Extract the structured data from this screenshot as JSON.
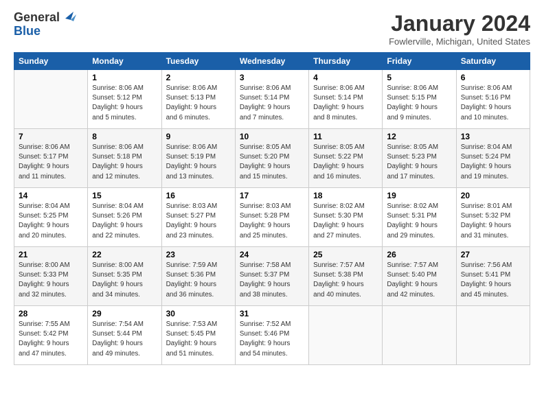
{
  "header": {
    "logo_line1": "General",
    "logo_line2": "Blue",
    "month": "January 2024",
    "location": "Fowlerville, Michigan, United States"
  },
  "weekdays": [
    "Sunday",
    "Monday",
    "Tuesday",
    "Wednesday",
    "Thursday",
    "Friday",
    "Saturday"
  ],
  "weeks": [
    [
      {
        "day": "",
        "info": ""
      },
      {
        "day": "1",
        "info": "Sunrise: 8:06 AM\nSunset: 5:12 PM\nDaylight: 9 hours\nand 5 minutes."
      },
      {
        "day": "2",
        "info": "Sunrise: 8:06 AM\nSunset: 5:13 PM\nDaylight: 9 hours\nand 6 minutes."
      },
      {
        "day": "3",
        "info": "Sunrise: 8:06 AM\nSunset: 5:14 PM\nDaylight: 9 hours\nand 7 minutes."
      },
      {
        "day": "4",
        "info": "Sunrise: 8:06 AM\nSunset: 5:14 PM\nDaylight: 9 hours\nand 8 minutes."
      },
      {
        "day": "5",
        "info": "Sunrise: 8:06 AM\nSunset: 5:15 PM\nDaylight: 9 hours\nand 9 minutes."
      },
      {
        "day": "6",
        "info": "Sunrise: 8:06 AM\nSunset: 5:16 PM\nDaylight: 9 hours\nand 10 minutes."
      }
    ],
    [
      {
        "day": "7",
        "info": "Sunrise: 8:06 AM\nSunset: 5:17 PM\nDaylight: 9 hours\nand 11 minutes."
      },
      {
        "day": "8",
        "info": "Sunrise: 8:06 AM\nSunset: 5:18 PM\nDaylight: 9 hours\nand 12 minutes."
      },
      {
        "day": "9",
        "info": "Sunrise: 8:06 AM\nSunset: 5:19 PM\nDaylight: 9 hours\nand 13 minutes."
      },
      {
        "day": "10",
        "info": "Sunrise: 8:05 AM\nSunset: 5:20 PM\nDaylight: 9 hours\nand 15 minutes."
      },
      {
        "day": "11",
        "info": "Sunrise: 8:05 AM\nSunset: 5:22 PM\nDaylight: 9 hours\nand 16 minutes."
      },
      {
        "day": "12",
        "info": "Sunrise: 8:05 AM\nSunset: 5:23 PM\nDaylight: 9 hours\nand 17 minutes."
      },
      {
        "day": "13",
        "info": "Sunrise: 8:04 AM\nSunset: 5:24 PM\nDaylight: 9 hours\nand 19 minutes."
      }
    ],
    [
      {
        "day": "14",
        "info": "Sunrise: 8:04 AM\nSunset: 5:25 PM\nDaylight: 9 hours\nand 20 minutes."
      },
      {
        "day": "15",
        "info": "Sunrise: 8:04 AM\nSunset: 5:26 PM\nDaylight: 9 hours\nand 22 minutes."
      },
      {
        "day": "16",
        "info": "Sunrise: 8:03 AM\nSunset: 5:27 PM\nDaylight: 9 hours\nand 23 minutes."
      },
      {
        "day": "17",
        "info": "Sunrise: 8:03 AM\nSunset: 5:28 PM\nDaylight: 9 hours\nand 25 minutes."
      },
      {
        "day": "18",
        "info": "Sunrise: 8:02 AM\nSunset: 5:30 PM\nDaylight: 9 hours\nand 27 minutes."
      },
      {
        "day": "19",
        "info": "Sunrise: 8:02 AM\nSunset: 5:31 PM\nDaylight: 9 hours\nand 29 minutes."
      },
      {
        "day": "20",
        "info": "Sunrise: 8:01 AM\nSunset: 5:32 PM\nDaylight: 9 hours\nand 31 minutes."
      }
    ],
    [
      {
        "day": "21",
        "info": "Sunrise: 8:00 AM\nSunset: 5:33 PM\nDaylight: 9 hours\nand 32 minutes."
      },
      {
        "day": "22",
        "info": "Sunrise: 8:00 AM\nSunset: 5:35 PM\nDaylight: 9 hours\nand 34 minutes."
      },
      {
        "day": "23",
        "info": "Sunrise: 7:59 AM\nSunset: 5:36 PM\nDaylight: 9 hours\nand 36 minutes."
      },
      {
        "day": "24",
        "info": "Sunrise: 7:58 AM\nSunset: 5:37 PM\nDaylight: 9 hours\nand 38 minutes."
      },
      {
        "day": "25",
        "info": "Sunrise: 7:57 AM\nSunset: 5:38 PM\nDaylight: 9 hours\nand 40 minutes."
      },
      {
        "day": "26",
        "info": "Sunrise: 7:57 AM\nSunset: 5:40 PM\nDaylight: 9 hours\nand 42 minutes."
      },
      {
        "day": "27",
        "info": "Sunrise: 7:56 AM\nSunset: 5:41 PM\nDaylight: 9 hours\nand 45 minutes."
      }
    ],
    [
      {
        "day": "28",
        "info": "Sunrise: 7:55 AM\nSunset: 5:42 PM\nDaylight: 9 hours\nand 47 minutes."
      },
      {
        "day": "29",
        "info": "Sunrise: 7:54 AM\nSunset: 5:44 PM\nDaylight: 9 hours\nand 49 minutes."
      },
      {
        "day": "30",
        "info": "Sunrise: 7:53 AM\nSunset: 5:45 PM\nDaylight: 9 hours\nand 51 minutes."
      },
      {
        "day": "31",
        "info": "Sunrise: 7:52 AM\nSunset: 5:46 PM\nDaylight: 9 hours\nand 54 minutes."
      },
      {
        "day": "",
        "info": ""
      },
      {
        "day": "",
        "info": ""
      },
      {
        "day": "",
        "info": ""
      }
    ]
  ]
}
